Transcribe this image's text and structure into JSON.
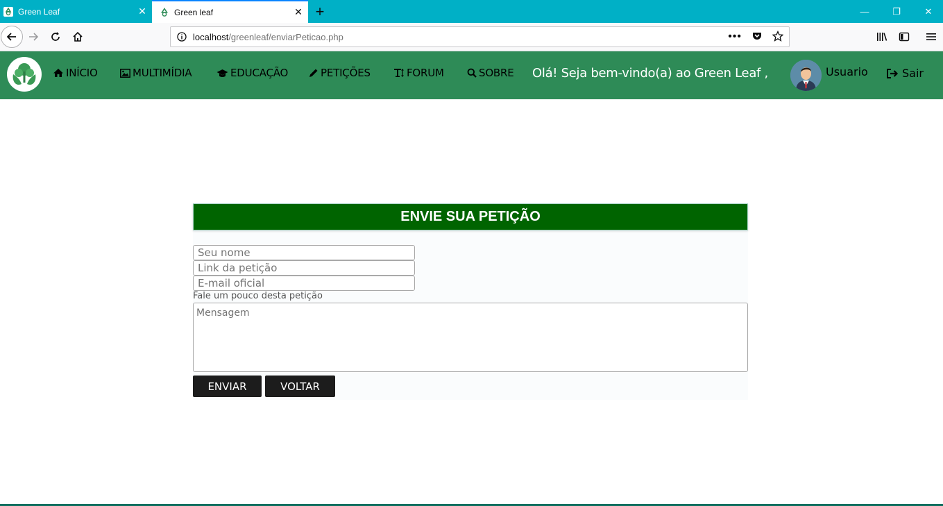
{
  "browser": {
    "tabs": [
      {
        "title": "Green Leaf",
        "active": false
      },
      {
        "title": "Green leaf",
        "active": true
      }
    ],
    "url_host": "localhost",
    "url_path": "/greenleaf/enviarPeticao.php"
  },
  "header": {
    "menu": [
      {
        "label": "INÍCIO",
        "icon": "home-icon"
      },
      {
        "label": "MULTIMÍDIA",
        "icon": "image-icon"
      },
      {
        "label": "EDUCAÇÃO",
        "icon": "graduation-cap-icon"
      },
      {
        "label": "PETIÇÕES",
        "icon": "pencil-icon"
      },
      {
        "label": "FORUM",
        "icon": "text-height-icon"
      },
      {
        "label": "SOBRE",
        "icon": "search-icon"
      }
    ],
    "welcome": "Olá! Seja bem-vindo(a) ao Green Leaf ,",
    "username": "Usuario",
    "logout_label": "Sair"
  },
  "form": {
    "title": "ENVIE SUA PETIÇÃO",
    "name_placeholder": "Seu nome",
    "link_placeholder": "Link da petição",
    "email_placeholder": "E-mail oficial",
    "hint": "Fale um pouco desta petição",
    "message_placeholder": "Mensagem",
    "submit_label": "ENVIAR",
    "back_label": "VOLTAR"
  },
  "colors": {
    "tabstrip": "#00b0c6",
    "header": "#2e8b57",
    "form_title_bg": "#006400",
    "button_bg": "#1c1c1c"
  }
}
